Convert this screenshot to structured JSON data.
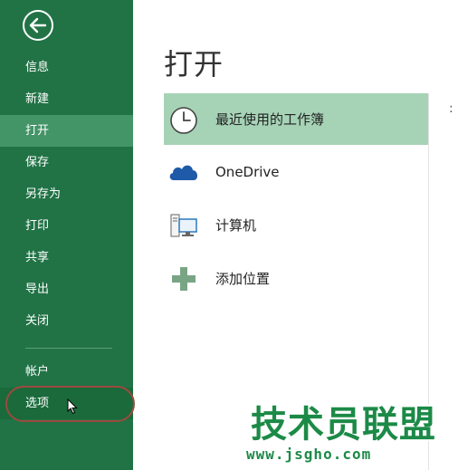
{
  "sidebar": {
    "items": [
      {
        "label": "信息"
      },
      {
        "label": "新建"
      },
      {
        "label": "打开",
        "selected": true
      },
      {
        "label": "保存"
      },
      {
        "label": "另存为"
      },
      {
        "label": "打印"
      },
      {
        "label": "共享"
      },
      {
        "label": "导出"
      },
      {
        "label": "关闭"
      }
    ],
    "bottom_items": [
      {
        "label": "帐户"
      },
      {
        "label": "选项",
        "highlighted": true
      }
    ]
  },
  "main": {
    "title": "打开",
    "locations": [
      {
        "label": "最近使用的工作簿",
        "icon": "clock-icon",
        "selected": true
      },
      {
        "label": "OneDrive",
        "icon": "cloud-icon"
      },
      {
        "label": "计算机",
        "icon": "computer-icon"
      },
      {
        "label": "添加位置",
        "icon": "plus-icon"
      }
    ]
  },
  "watermark": {
    "title": "技术员联盟",
    "url": "www.jsgho.com"
  },
  "colors": {
    "sidebar_bg": "#217346",
    "sidebar_selected": "#439467",
    "location_selected": "#a6d3b6",
    "watermark": "#1c8a47"
  }
}
